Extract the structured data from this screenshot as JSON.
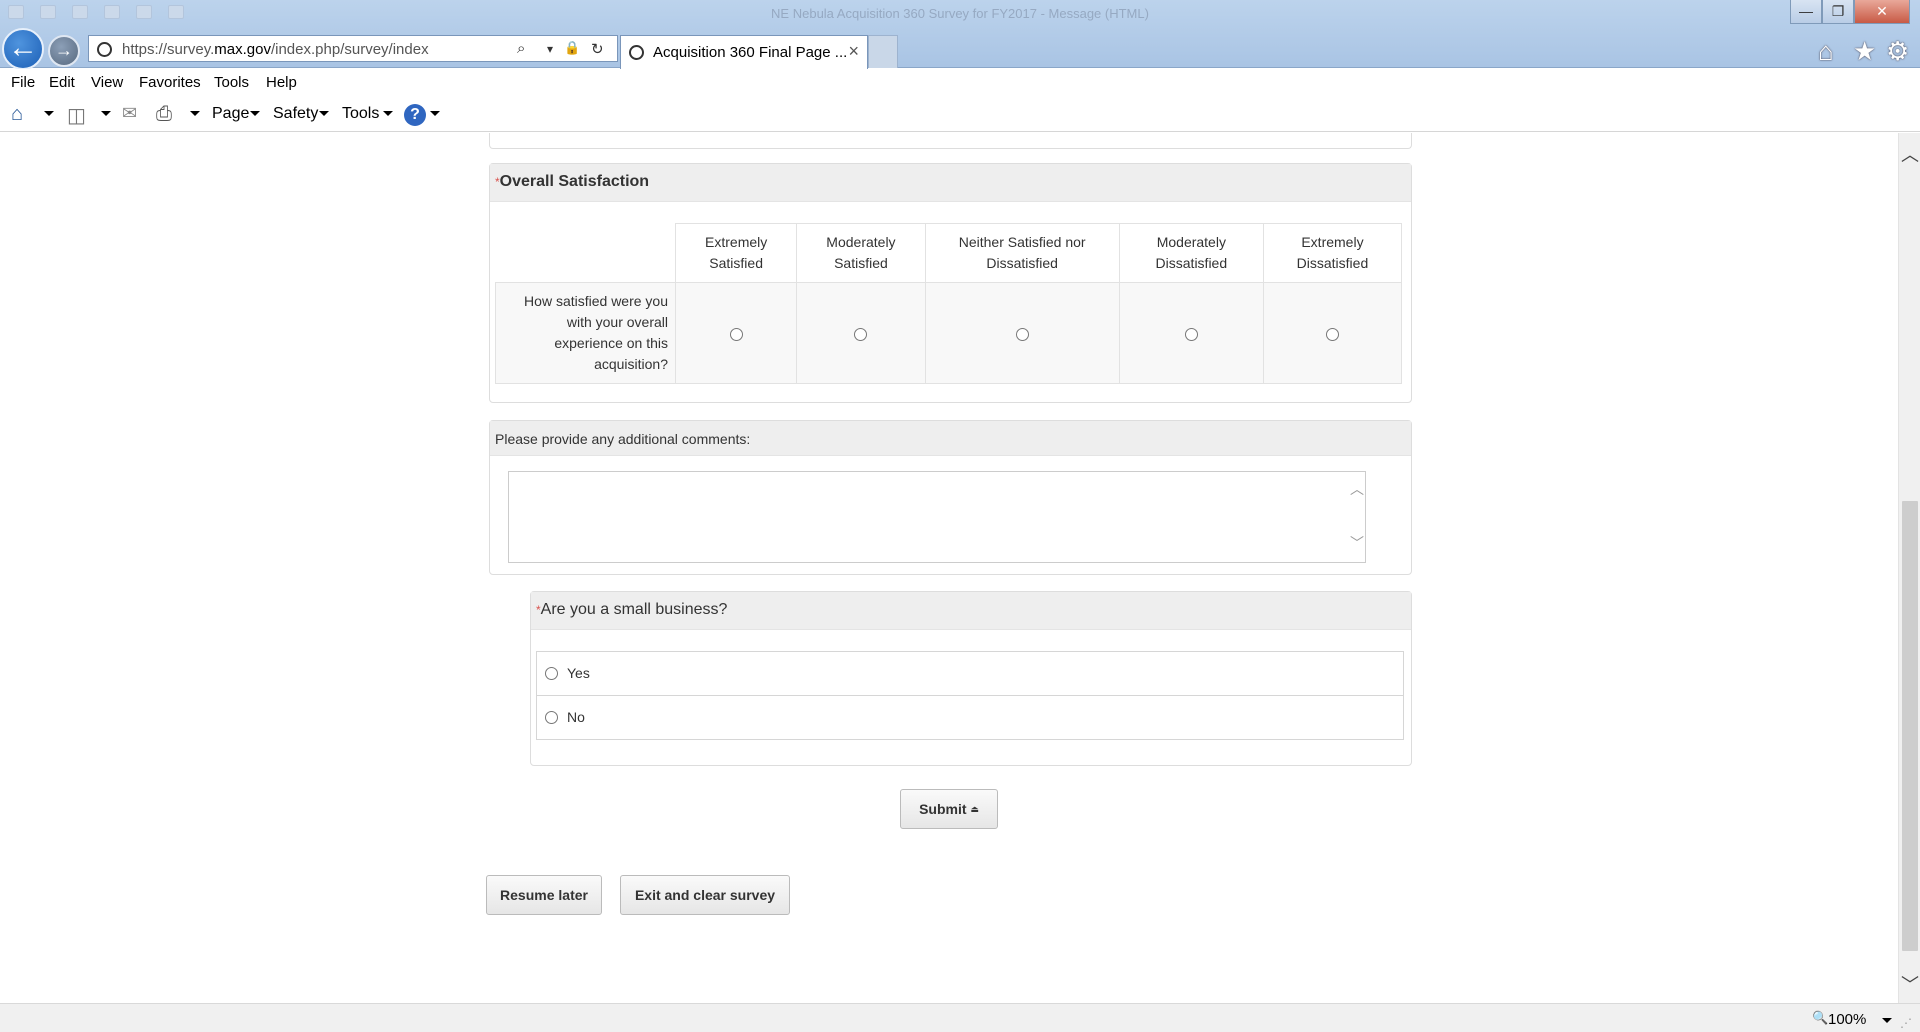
{
  "window": {
    "title": "NE Nebula Acquisition 360 Survey for FY2017 - Message (HTML)",
    "minimize_glyph": "—",
    "restore_glyph": "❐",
    "close_glyph": "✕"
  },
  "browser": {
    "back_glyph": "←",
    "forward_glyph": "→",
    "url_prefix": "https://survey.",
    "url_domain": "max.gov",
    "url_path": "/index.php/survey/index",
    "search_glyph": "⌕",
    "dropdown_glyph": "▾",
    "lock_glyph": "🔒",
    "refresh_glyph": "↻",
    "active_tab_title": "Acquisition 360 Final Page ...",
    "tab_close_glyph": "×",
    "home_glyph": "⌂",
    "favorites_glyph": "★",
    "settings_glyph": "⚙"
  },
  "menu": {
    "file": "File",
    "edit": "Edit",
    "view": "View",
    "favorites": "Favorites",
    "tools": "Tools",
    "help": "Help"
  },
  "commandbar": {
    "home_glyph": "⌂",
    "feeds_glyph": "◫",
    "mail_glyph": "✉",
    "print_glyph": "⎙",
    "page": "Page",
    "safety": "Safety",
    "tools": "Tools",
    "help_glyph": "?"
  },
  "survey": {
    "overall": {
      "required_mark": "*",
      "title": "Overall Satisfaction",
      "columns": [
        "Extremely Satisfied",
        "Moderately Satisfied",
        "Neither Satisfied nor Dissatisfied",
        "Moderately Dissatisfied",
        "Extremely Dissatisfied"
      ],
      "question": "How satisfied were you with your overall experience on this acquisition?"
    },
    "comments": {
      "title": "Please provide any additional comments:",
      "value": "",
      "scroll_up_glyph": "︿",
      "scroll_down_glyph": "﹀"
    },
    "small_business": {
      "required_mark": "*",
      "title": "Are you a small business?",
      "options": [
        "Yes",
        "No"
      ]
    },
    "submit_label": "Submit",
    "submit_glyph": "⏏",
    "resume_label": "Resume later",
    "exit_label": "Exit and clear survey"
  },
  "scrollbar": {
    "up_glyph": "︿",
    "down_glyph": "﹀"
  },
  "statusbar": {
    "zoom_glyph": "🔍",
    "zoom_level": "100%",
    "grip_glyph": "⋰"
  }
}
